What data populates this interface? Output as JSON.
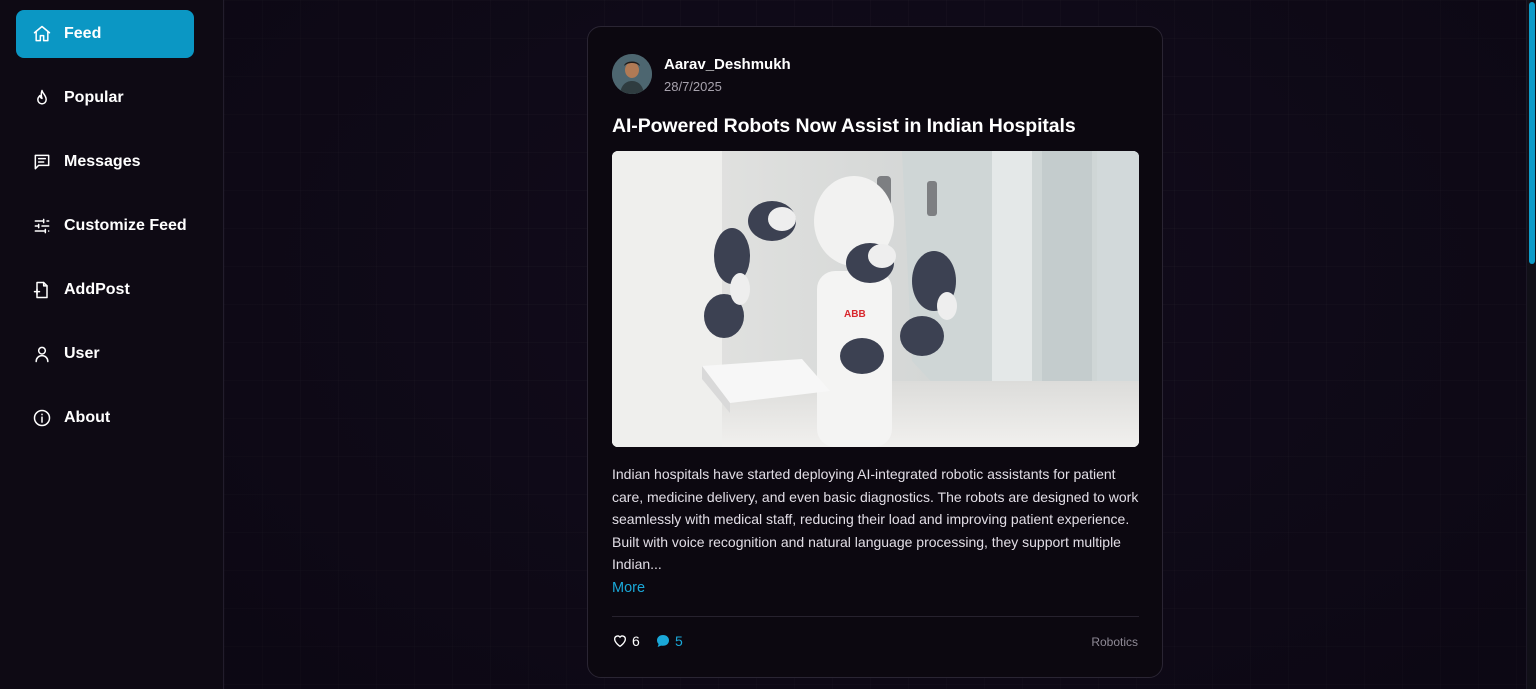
{
  "sidebar": {
    "items": [
      {
        "label": "Feed",
        "icon": "home-icon",
        "active": true
      },
      {
        "label": "Popular",
        "icon": "flame-icon",
        "active": false
      },
      {
        "label": "Messages",
        "icon": "message-icon",
        "active": false
      },
      {
        "label": "Customize Feed",
        "icon": "sliders-icon",
        "active": false
      },
      {
        "label": "AddPost",
        "icon": "file-plus-icon",
        "active": false
      },
      {
        "label": "User",
        "icon": "user-icon",
        "active": false
      },
      {
        "label": "About",
        "icon": "info-icon",
        "active": false
      }
    ]
  },
  "post": {
    "author": "Aarav_Deshmukh",
    "date": "28/7/2025",
    "title": "AI-Powered Robots Now Assist in Indian Hospitals",
    "image_alt": "ABB robot in a hospital corridor",
    "body": "Indian hospitals have started deploying AI-integrated robotic assistants for patient care, medicine delivery, and even basic diagnostics. The robots are designed to work seamlessly with medical staff, reducing their load and improving patient experience. Built with voice recognition and natural language processing, they support multiple Indian...",
    "more_label": "More",
    "likes": "6",
    "comments": "5",
    "tag": "Robotics"
  },
  "colors": {
    "accent": "#0b97c4",
    "link": "#1aa8d8",
    "background": "#120c1c",
    "card": "#0c0810"
  }
}
